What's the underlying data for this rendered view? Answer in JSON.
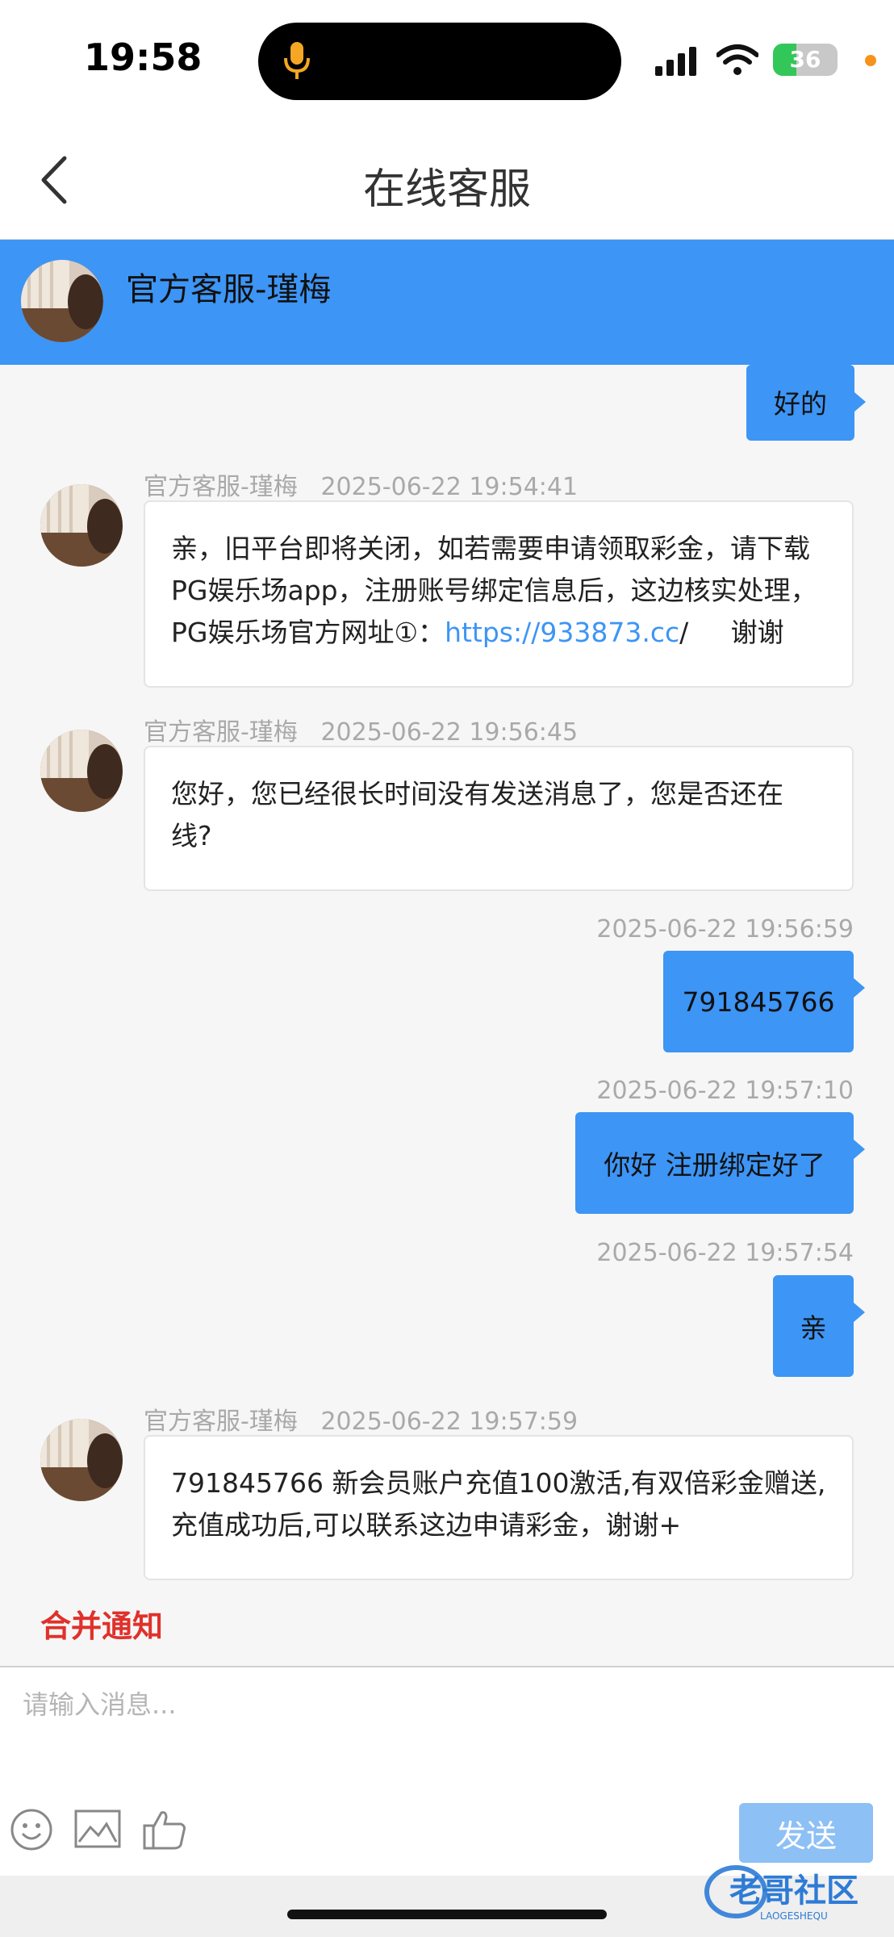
{
  "status_bar": {
    "time": "19:58",
    "battery": "36",
    "battery_level": 0.36
  },
  "nav": {
    "title": "在线客服"
  },
  "agent": {
    "name": "官方客服-瑾梅"
  },
  "messages": {
    "m0": {
      "text": "好的"
    },
    "m1": {
      "sender": "官方客服-瑾梅",
      "time": "2025-06-22 19:54:41",
      "line1": "亲，旧平台即将关闭，如若需要申请领取彩金，请下载",
      "line2": "PG娱乐场app，注册账号绑定信息后，这边核实处理，",
      "line3_pre": "PG娱乐场官方网址①：",
      "link": "https://933873.cc",
      "line3_post": "/     谢谢"
    },
    "m2": {
      "sender": "官方客服-瑾梅",
      "time": "2025-06-22 19:56:45",
      "line1": "您好，您已经很长时间没有发送消息了，您是否还在",
      "line2": "线?"
    },
    "m3": {
      "time": "2025-06-22 19:56:59",
      "text": "791845766"
    },
    "m4": {
      "time": "2025-06-22 19:57:10",
      "text": "你好 注册绑定好了"
    },
    "m5": {
      "time": "2025-06-22 19:57:54",
      "text": "亲"
    },
    "m6": {
      "sender": "官方客服-瑾梅",
      "time": "2025-06-22 19:57:59",
      "line1": "791845766 新会员账户充值100激活,有双倍彩金赠送,",
      "line2": "充值成功后,可以联系这边申请彩金，谢谢+"
    }
  },
  "merge_notice": "合并通知",
  "composer": {
    "placeholder": "请输入消息...",
    "send_label": "发送"
  },
  "watermark": {
    "text": "老哥社区",
    "subtext": "LAOGESHEQU"
  },
  "colors": {
    "accent": "#3d95f5",
    "send_disabled": "#8dc0f5",
    "merge": "#e0312b"
  },
  "icons": [
    "mic-icon",
    "signal-icon",
    "wifi-icon",
    "battery-icon",
    "back-chevron-icon",
    "emoji-icon",
    "image-icon",
    "thumbs-up-icon"
  ]
}
